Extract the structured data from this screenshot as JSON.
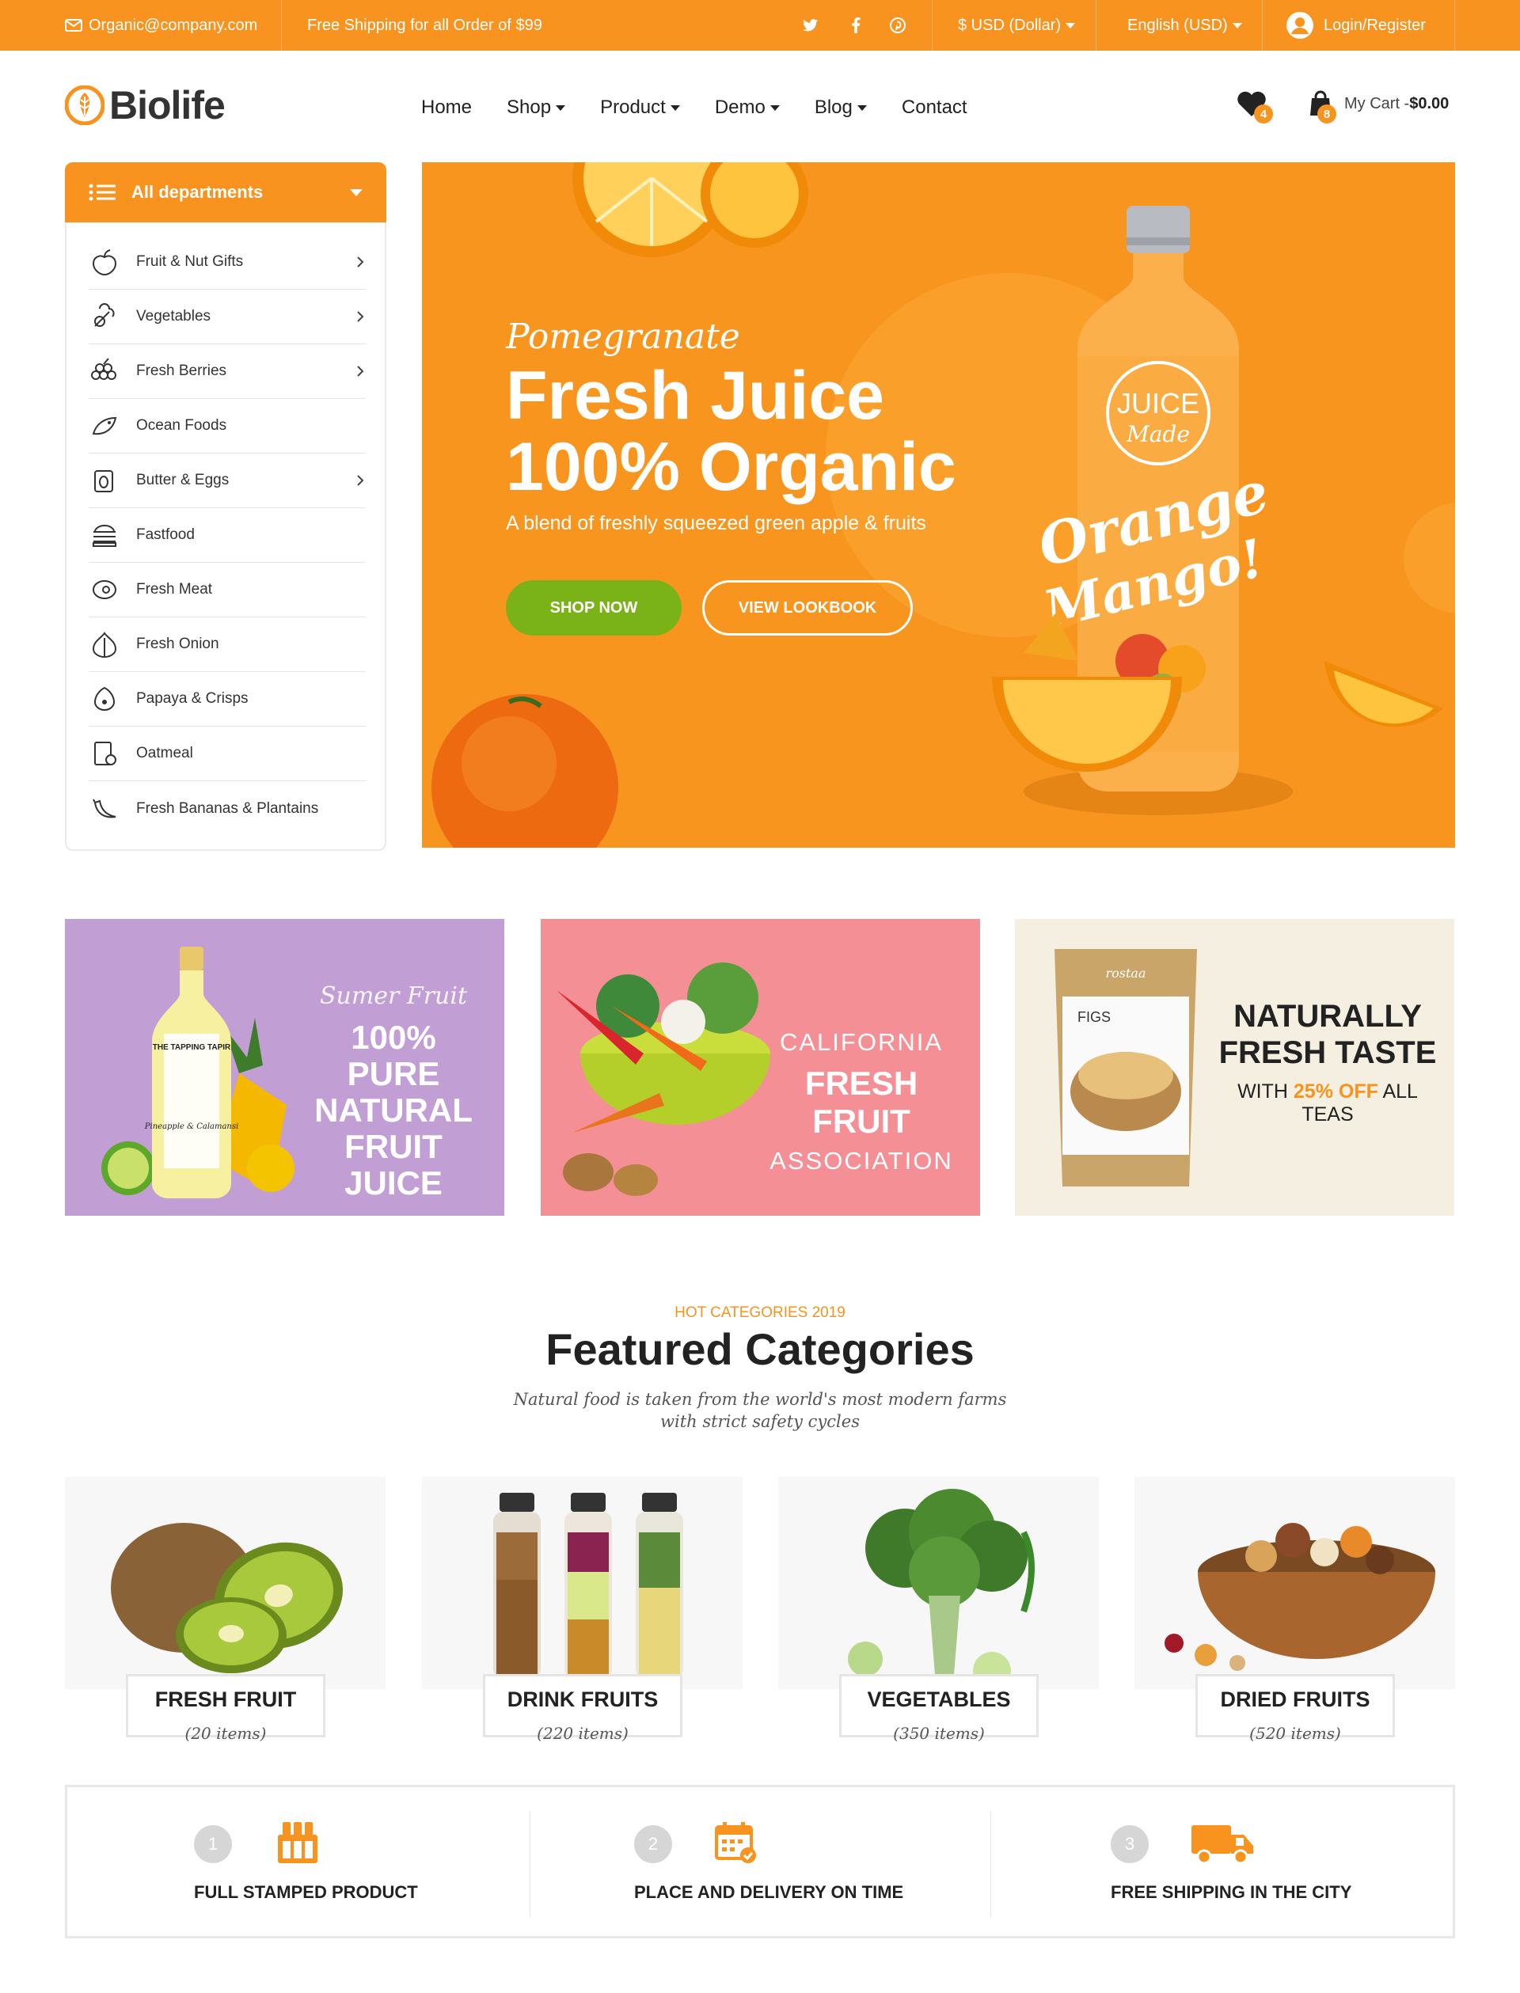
{
  "topbar": {
    "email": "Organic@company.com",
    "shipping_notice": "Free Shipping for all Order of $99",
    "currency": "$ USD (Dollar)",
    "language": "English (USD)",
    "login": "Login/Register",
    "social_icons": [
      "twitter-icon",
      "facebook-icon",
      "pinterest-icon"
    ]
  },
  "header": {
    "logo_text": "Biolife",
    "nav": [
      {
        "label": "Home",
        "dropdown": false
      },
      {
        "label": "Shop",
        "dropdown": true
      },
      {
        "label": "Product",
        "dropdown": true
      },
      {
        "label": "Demo",
        "dropdown": true
      },
      {
        "label": "Blog",
        "dropdown": true
      },
      {
        "label": "Contact",
        "dropdown": false
      }
    ],
    "wishlist_count": "4",
    "cart_count": "8",
    "cart_label": "My Cart -",
    "cart_total": "$0.00"
  },
  "sidebar": {
    "title": "All departments",
    "items": [
      {
        "label": "Fruit & Nut Gifts",
        "has_sub": true,
        "icon": "fruit-nut-icon"
      },
      {
        "label": "Vegetables",
        "has_sub": true,
        "icon": "vegetables-icon"
      },
      {
        "label": "Fresh Berries",
        "has_sub": true,
        "icon": "berries-icon"
      },
      {
        "label": "Ocean Foods",
        "has_sub": false,
        "icon": "ocean-foods-icon"
      },
      {
        "label": "Butter & Eggs",
        "has_sub": true,
        "icon": "butter-eggs-icon"
      },
      {
        "label": "Fastfood",
        "has_sub": false,
        "icon": "fastfood-icon"
      },
      {
        "label": "Fresh Meat",
        "has_sub": false,
        "icon": "meat-icon"
      },
      {
        "label": "Fresh Onion",
        "has_sub": false,
        "icon": "onion-icon"
      },
      {
        "label": "Papaya & Crisps",
        "has_sub": false,
        "icon": "papaya-icon"
      },
      {
        "label": "Oatmeal",
        "has_sub": false,
        "icon": "oatmeal-icon"
      },
      {
        "label": "Fresh Bananas & Plantains",
        "has_sub": false,
        "icon": "banana-icon"
      }
    ]
  },
  "hero": {
    "subtitle": "Pomegranate",
    "title_line1": "Fresh Juice",
    "title_line2": "100% Organic",
    "description": "A blend of freshly squeezed green apple & fruits",
    "shop_now": "SHOP NOW",
    "view_lookbook": "VIEW LOOKBOOK",
    "bottle_label_line1": "JUICE",
    "bottle_label_line2": "Made",
    "bottle_script_line1": "Orange",
    "bottle_script_line2": "Mango!"
  },
  "banners": [
    {
      "kicker": "Sumer Fruit",
      "line1": "100% PURE",
      "line2": "NATURAL",
      "line3": "FRUIT JUICE",
      "bottle_label": "THE TAPPING TAPIR",
      "bottle_flavor": "Pineapple & Calamansi"
    },
    {
      "line1": "CALIFORNIA",
      "line2": "FRESH FRUIT",
      "line3": "ASSOCIATION"
    },
    {
      "line1": "NATURALLY",
      "line2": "FRESH TASTE",
      "offer_prefix": "WITH ",
      "offer_highlight": "25% OFF",
      "offer_suffix": " ALL TEAS",
      "bag_brand": "rostaa",
      "bag_product": "FIGS"
    }
  ],
  "featured": {
    "kicker": "HOT CATEGORIES 2019",
    "title": "Featured Categories",
    "description": "Natural food is taken from the world's most modern farms with strict safety cycles",
    "categories": [
      {
        "name": "FRESH FRUIT",
        "count": "(20 items)"
      },
      {
        "name": "DRINK FRUITS",
        "count": "(220 items)"
      },
      {
        "name": "VEGETABLES",
        "count": "(350 items)"
      },
      {
        "name": "DRIED FRUITS",
        "count": "(520 items)"
      }
    ]
  },
  "features": [
    {
      "number": "1",
      "label": "FULL STAMPED PRODUCT",
      "icon": "stamped-product-icon"
    },
    {
      "number": "2",
      "label": "PLACE AND DELIVERY ON TIME",
      "icon": "calendar-delivery-icon"
    },
    {
      "number": "3",
      "label": "FREE SHIPPING IN THE CITY",
      "icon": "truck-icon"
    }
  ],
  "colors": {
    "brand_orange": "#f7931e",
    "button_green": "#7ab317",
    "banner_purple": "#c19fd5",
    "banner_pink": "#f58f96",
    "banner_cream": "#f4efe0"
  }
}
